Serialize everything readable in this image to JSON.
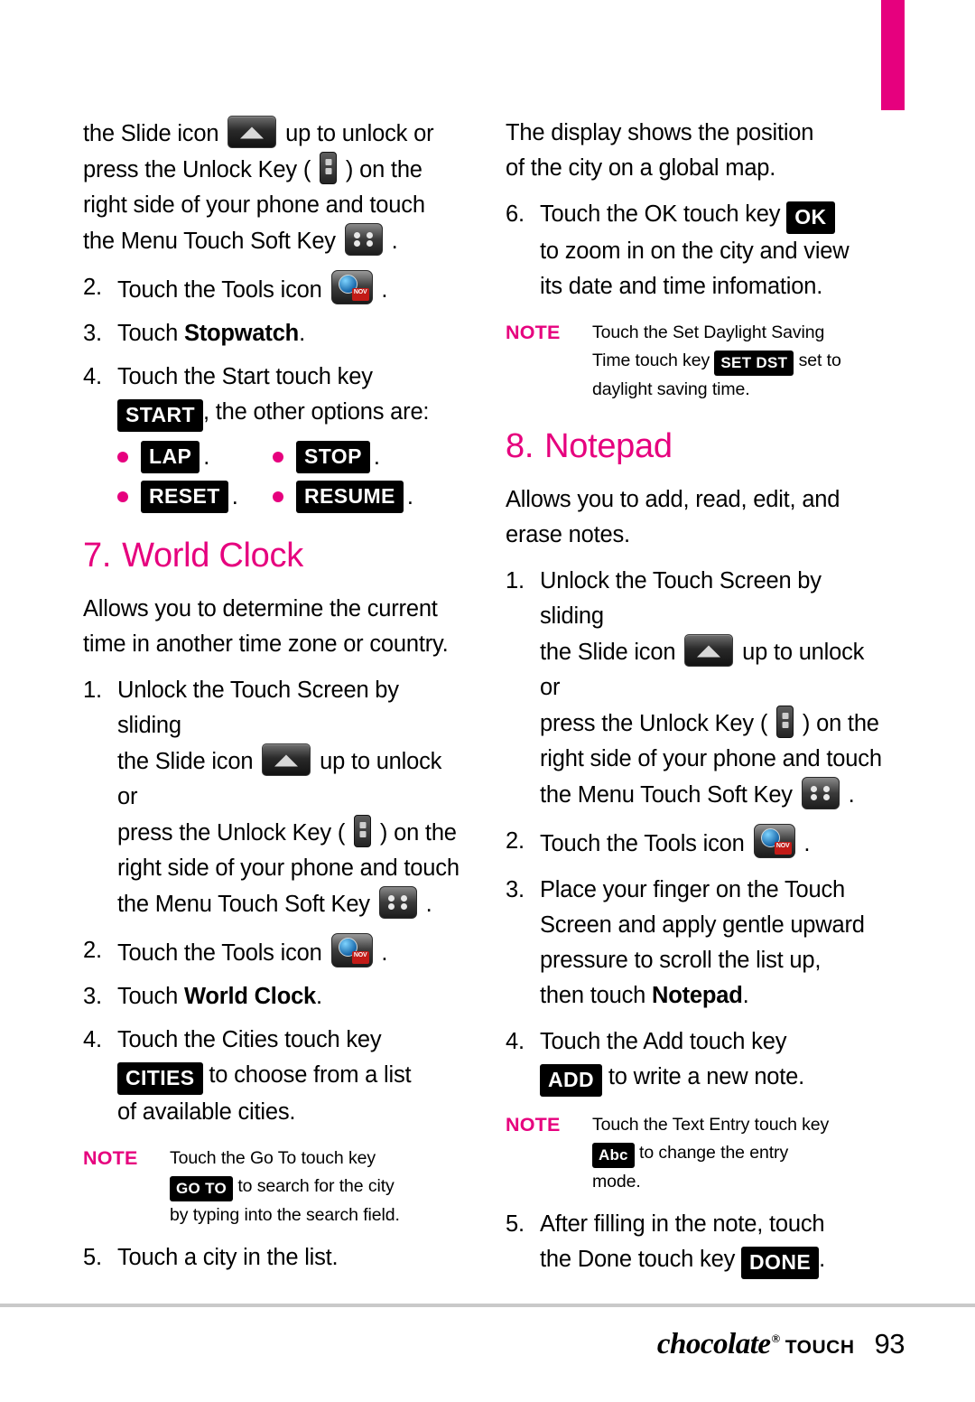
{
  "page": {
    "number": "93",
    "brand": "chocolate",
    "brand_reg": "®",
    "brand_sub": "TOUCH"
  },
  "left_column": {
    "continued_step": {
      "line1_a": "the Slide icon",
      "line1_b": "up to unlock or",
      "line2_a": "press the Unlock Key (",
      "line2_b": ") on the",
      "line3": "right side of your phone and touch",
      "line4_a": "the Menu Touch Soft Key",
      "line4_b": "."
    },
    "step2": {
      "num": "2.",
      "text_a": "Touch the Tools icon",
      "text_b": "."
    },
    "step3": {
      "num": "3.",
      "text_a": "Touch ",
      "bold": "Stopwatch",
      "text_b": "."
    },
    "step4": {
      "num": "4.",
      "line1": "Touch the Start touch key",
      "chip": "START",
      "line2": ", the other options are:"
    },
    "keys": [
      {
        "label": "LAP",
        "after": "."
      },
      {
        "label": "STOP",
        "after": "."
      },
      {
        "label": "RESET",
        "after": "."
      },
      {
        "label": "RESUME",
        "after": "."
      }
    ],
    "section7": {
      "num": "7.",
      "title": "World Clock",
      "intro_line1": "Allows you to determine the current",
      "intro_line2": "time in another time zone or country."
    },
    "wc_step1": {
      "num": "1.",
      "line1": "Unlock the Touch Screen by sliding",
      "line2_a": "the Slide icon",
      "line2_b": "up to unlock or",
      "line3_a": "press the Unlock Key (",
      "line3_b": ") on the",
      "line4": "right side of your phone and touch",
      "line5_a": "the Menu Touch Soft Key",
      "line5_b": "."
    },
    "wc_step2": {
      "num": "2.",
      "text_a": "Touch the Tools icon",
      "text_b": "."
    },
    "wc_step3": {
      "num": "3.",
      "text_a": "Touch ",
      "bold": "World Clock",
      "text_b": "."
    },
    "wc_step4": {
      "num": "4.",
      "line1": "Touch the Cities touch key",
      "chip": "CITIES",
      "line2": "to choose from a list",
      "line3": "of available cities."
    },
    "wc_note": {
      "label": "NOTE",
      "line1": "Touch the Go To touch key",
      "chip": "GO TO",
      "line2": "to search for the city",
      "line3": "by typing into the search field."
    },
    "wc_step5": {
      "num": "5.",
      "text": "Touch a city in the list."
    }
  },
  "right_column": {
    "display_note": {
      "line1": "The display shows the position",
      "line2": "of the city on a global map."
    },
    "step6": {
      "num": "6.",
      "line1": "Touch the OK touch key",
      "chip": "OK",
      "line2": "to zoom in on the city and view",
      "line3": "its date and time infomation."
    },
    "dst_note": {
      "label": "NOTE",
      "line1": "Touch the Set Daylight Saving",
      "line2a": "Time touch key",
      "chip": "SET DST",
      "line2b": "set to",
      "line3": "daylight saving time."
    },
    "section8": {
      "num": "8.",
      "title": "Notepad",
      "intro_line1": "Allows you to add, read, edit, and",
      "intro_line2": "erase notes."
    },
    "np_step1": {
      "num": "1.",
      "line1": "Unlock the Touch Screen by sliding",
      "line2_a": "the Slide icon",
      "line2_b": "up to unlock or",
      "line3_a": "press the Unlock Key (",
      "line3_b": ") on the",
      "line4": "right side of your phone and touch",
      "line5_a": "the Menu Touch Soft Key",
      "line5_b": "."
    },
    "np_step2": {
      "num": "2.",
      "text_a": "Touch the Tools icon",
      "text_b": "."
    },
    "np_step3": {
      "num": "3.",
      "line1": "Place your finger on the Touch",
      "line2": "Screen and apply gentle upward",
      "line3": "pressure to scroll the list up,",
      "line4_a": "then touch ",
      "line4_bold": "Notepad",
      "line4_b": "."
    },
    "np_step4": {
      "num": "4.",
      "line1": "Touch the Add touch key",
      "chip": "ADD",
      "line2": "to write a new note."
    },
    "np_note": {
      "label": "NOTE",
      "line1": "Touch the Text Entry touch key",
      "chip": "Abc",
      "line2": "to change the entry",
      "line3": "mode."
    },
    "np_step5": {
      "num": "5.",
      "line1": "After filling in the note, touch",
      "line2": "the Done touch key",
      "chip": "DONE",
      "line3": "."
    }
  },
  "colors": {
    "accent": "#e6007e",
    "chip_bg": "#000000",
    "rule": "#c9c9c9"
  }
}
